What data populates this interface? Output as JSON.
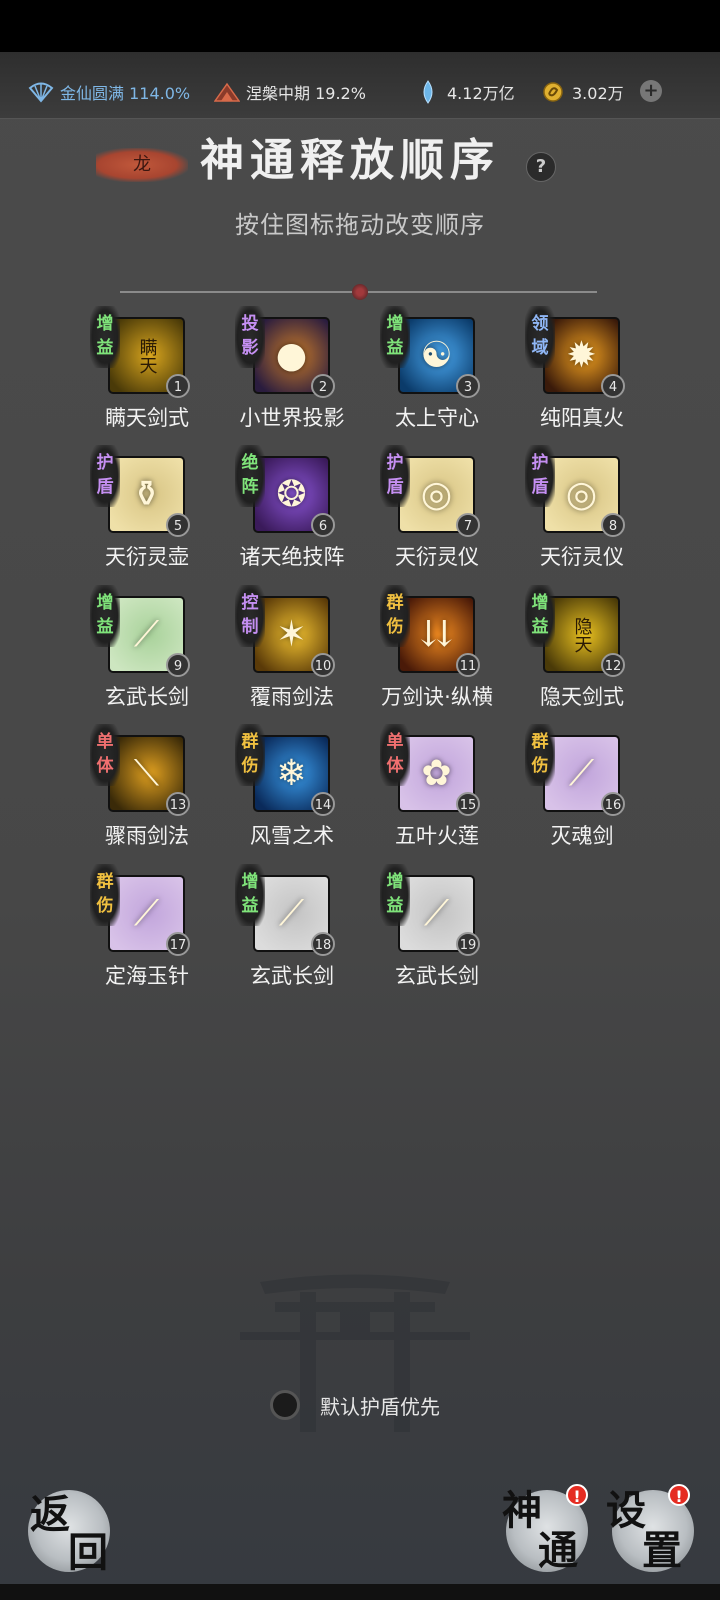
{
  "header": {
    "realm": {
      "icon": "fan-icon",
      "text": "金仙圆满 114.0%"
    },
    "stage": {
      "icon": "lotus-peak-icon",
      "text": "涅槃中期 19.2%"
    },
    "gems": {
      "icon": "crystal-icon",
      "text": "4.12万亿"
    },
    "gold": {
      "icon": "coin-icon",
      "text": "3.02万"
    },
    "add_label": "+"
  },
  "panel": {
    "tag": "龙",
    "title": "神通释放顺序",
    "help": "?",
    "subtitle": "按住图标拖动改变顺序"
  },
  "skills": [
    {
      "order": "1",
      "name": "瞒天剑式",
      "tag": "增\n益",
      "tag_color": "#7fe37a",
      "icon": "golden-sword-icon",
      "bg": [
        "#4a3a08",
        "#d8a51e"
      ],
      "glyph": "瞒天"
    },
    {
      "order": "2",
      "name": "小世界投影",
      "tag": "投\n影",
      "tag_color": "#c58ff2",
      "icon": "black-hole-icon",
      "bg": [
        "#2a1c3e",
        "#c77a2a"
      ],
      "glyph": "●"
    },
    {
      "order": "3",
      "name": "太上守心",
      "tag": "增\n益",
      "tag_color": "#7fe37a",
      "icon": "meditating-figure-icon",
      "bg": [
        "#0b3b6a",
        "#4aa8f0"
      ],
      "glyph": "☯"
    },
    {
      "order": "4",
      "name": "纯阳真火",
      "tag": "领\n域",
      "tag_color": "#8fb6f5",
      "icon": "flame-icon",
      "bg": [
        "#3a1a0a",
        "#f0a020"
      ],
      "glyph": "✹"
    },
    {
      "order": "5",
      "name": "天衍灵壶",
      "tag": "护\n盾",
      "tag_color": "#c58ff2",
      "icon": "spirit-pot-icon",
      "bg": [
        "#efe0a8",
        "#d8c585"
      ],
      "glyph": "⚱"
    },
    {
      "order": "6",
      "name": "诸天绝技阵",
      "tag": "绝\n阵",
      "tag_color": "#7fe37a",
      "icon": "formation-orbs-icon",
      "bg": [
        "#3a1a5a",
        "#8a55d5"
      ],
      "glyph": "❂"
    },
    {
      "order": "7",
      "name": "天衍灵仪",
      "tag": "护\n盾",
      "tag_color": "#c58ff2",
      "icon": "spirit-disc-icon",
      "bg": [
        "#efe0a8",
        "#d8c585"
      ],
      "glyph": "◎"
    },
    {
      "order": "8",
      "name": "天衍灵仪",
      "tag": "护\n盾",
      "tag_color": "#c58ff2",
      "icon": "spirit-disc-icon",
      "bg": [
        "#efe0a8",
        "#d8c585"
      ],
      "glyph": "◎"
    },
    {
      "order": "9",
      "name": "玄武长剑",
      "tag": "增\n益",
      "tag_color": "#7fe37a",
      "icon": "long-sword-icon",
      "bg": [
        "#cde6c0",
        "#a9d29b"
      ],
      "glyph": "⟋"
    },
    {
      "order": "10",
      "name": "覆雨剑法",
      "tag": "控\n制",
      "tag_color": "#c58ff2",
      "icon": "sword-burst-icon",
      "bg": [
        "#5a3a08",
        "#f0c030"
      ],
      "glyph": "✶"
    },
    {
      "order": "11",
      "name": "万剑诀·纵横",
      "tag": "群\n伤",
      "tag_color": "#f0c040",
      "icon": "sword-rain-icon",
      "bg": [
        "#4a1a08",
        "#f08a20"
      ],
      "glyph": "⇊"
    },
    {
      "order": "12",
      "name": "隐天剑式",
      "tag": "增\n益",
      "tag_color": "#7fe37a",
      "icon": "hidden-sky-icon",
      "bg": [
        "#4a3a08",
        "#e8c020"
      ],
      "glyph": "隐天"
    },
    {
      "order": "13",
      "name": "骤雨剑法",
      "tag": "单\n体",
      "tag_color": "#f07070",
      "icon": "slash-icon",
      "bg": [
        "#3a2a08",
        "#e0a020"
      ],
      "glyph": "⟍"
    },
    {
      "order": "14",
      "name": "风雪之术",
      "tag": "群\n伤",
      "tag_color": "#f0c040",
      "icon": "blizzard-icon",
      "bg": [
        "#0a2a5a",
        "#3a9ae8"
      ],
      "glyph": "❄"
    },
    {
      "order": "15",
      "name": "五叶火莲",
      "tag": "单\n体",
      "tag_color": "#f07070",
      "icon": "fire-lotus-icon",
      "bg": [
        "#d8c2e8",
        "#c2a6dc"
      ],
      "glyph": "✿"
    },
    {
      "order": "16",
      "name": "灭魂剑",
      "tag": "群\n伤",
      "tag_color": "#f0c040",
      "icon": "soul-sword-icon",
      "bg": [
        "#d8c2e8",
        "#c2a6dc"
      ],
      "glyph": "⟋"
    },
    {
      "order": "17",
      "name": "定海玉针",
      "tag": "群\n伤",
      "tag_color": "#f0c040",
      "icon": "jade-needle-icon",
      "bg": [
        "#d8c2e8",
        "#c2a6dc"
      ],
      "glyph": "⟋"
    },
    {
      "order": "18",
      "name": "玄武长剑",
      "tag": "增\n益",
      "tag_color": "#7fe37a",
      "icon": "long-sword-icon",
      "bg": [
        "#dcdcdc",
        "#c4c4c4"
      ],
      "glyph": "⟋"
    },
    {
      "order": "19",
      "name": "玄武长剑",
      "tag": "增\n益",
      "tag_color": "#7fe37a",
      "icon": "long-sword-icon",
      "bg": [
        "#dcdcdc",
        "#c4c4c4"
      ],
      "glyph": "⟋"
    }
  ],
  "footer": {
    "toggle_label": "默认护盾优先",
    "back": {
      "top": "返",
      "bottom": "回"
    },
    "skills_btn": {
      "top": "神",
      "bottom": "通",
      "badge": "!"
    },
    "settings_btn": {
      "top": "设",
      "bottom": "置",
      "badge": "!"
    }
  }
}
